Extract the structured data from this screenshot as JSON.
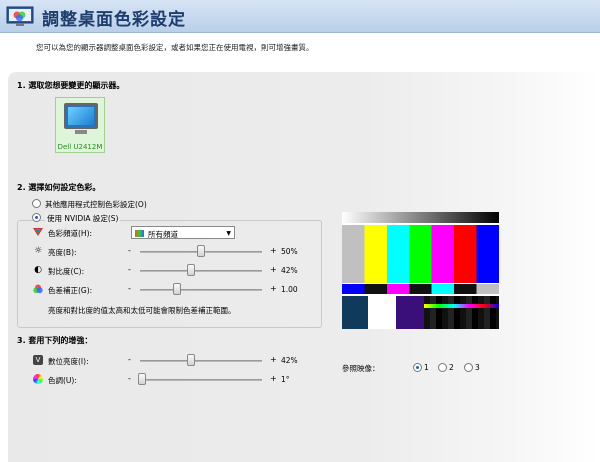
{
  "header": {
    "title": "調整桌面色彩設定",
    "icon": "display-color-icon"
  },
  "description": "您可以為您的顯示器調整桌面色彩設定，或者如果您正在使用電視，則可增強畫質。",
  "section1": {
    "heading": "1. 選取您想要變更的顯示器。",
    "monitor_label": "Dell U2412M"
  },
  "section2": {
    "heading": "2. 選擇如何設定色彩。",
    "option_other": "其他應用程式控制色彩設定(O)",
    "option_nvidia": "使用 NVIDIA 設定(S)",
    "channel_label": "色彩頻道(H):",
    "channel_value": "所有頻道",
    "rows": [
      {
        "label": "亮度(B):",
        "value": "50%",
        "level": 0.5,
        "icon": "brightness-icon"
      },
      {
        "label": "對比度(C):",
        "value": "42%",
        "level": 0.42,
        "icon": "contrast-icon"
      },
      {
        "label": "色差補正(G):",
        "value": "1.00",
        "level": 0.3,
        "icon": "gamma-icon"
      }
    ],
    "note": "亮度和對比度的值太高和太低可能會限制色差補正範圍。"
  },
  "section3": {
    "heading": "3. 套用下列的增強：",
    "rows": [
      {
        "label": "數位亮度(I):",
        "value": "42%",
        "level": 0.42,
        "icon": "digital-vibrance-icon"
      },
      {
        "label": "色調(U):",
        "value": "1°",
        "level": 0.02,
        "icon": "hue-icon"
      }
    ]
  },
  "minus": "-",
  "plus": "+",
  "reference": {
    "label": "參照映像：",
    "options": [
      "1",
      "2",
      "3"
    ],
    "selected": "1"
  }
}
